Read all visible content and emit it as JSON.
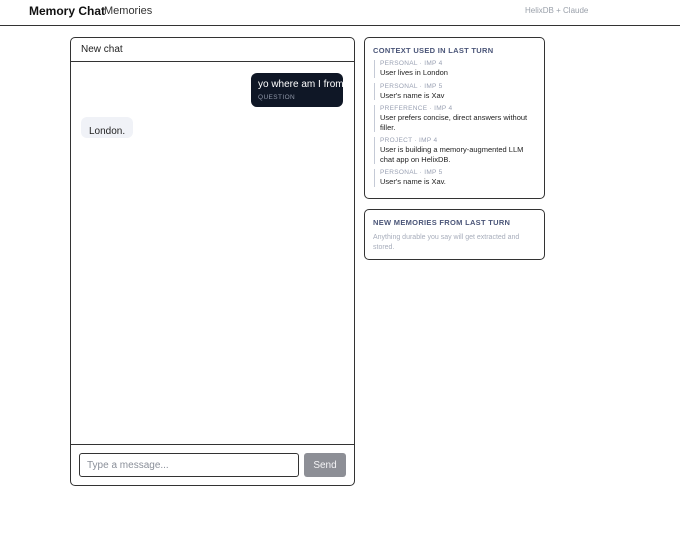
{
  "app": {
    "brand": "Memory Chat",
    "nav_memories": "Memories",
    "powered_by": "HelixDB + Claude"
  },
  "chat": {
    "title": "New chat",
    "messages": [
      {
        "role": "user",
        "text": "yo where am I from",
        "tag": "QUESTION"
      },
      {
        "role": "assistant",
        "text": "London."
      }
    ],
    "input_placeholder": "Type a message...",
    "input_value": "",
    "send_label": "Send"
  },
  "context_card": {
    "title": "CONTEXT USED IN LAST TURN",
    "items": [
      {
        "meta": "PERSONAL · IMP 4",
        "text": "User lives in London"
      },
      {
        "meta": "PERSONAL · IMP 5",
        "text": "User's name is Xav"
      },
      {
        "meta": "PREFERENCE · IMP 4",
        "text": "User prefers concise, direct answers without filler."
      },
      {
        "meta": "PROJECT · IMP 4",
        "text": "User is building a memory-augmented LLM chat app on HelixDB."
      },
      {
        "meta": "PERSONAL · IMP 5",
        "text": "User's name is Xav."
      }
    ]
  },
  "new_memories_card": {
    "title": "NEW MEMORIES FROM LAST TURN",
    "empty_text": "Anything durable you say will get extracted and stored."
  },
  "colors": {
    "user_bubble": "#0f1726",
    "assistant_bubble": "#f0f2f7",
    "send_button": "#8d8f96",
    "card_title": "#4a5578"
  }
}
